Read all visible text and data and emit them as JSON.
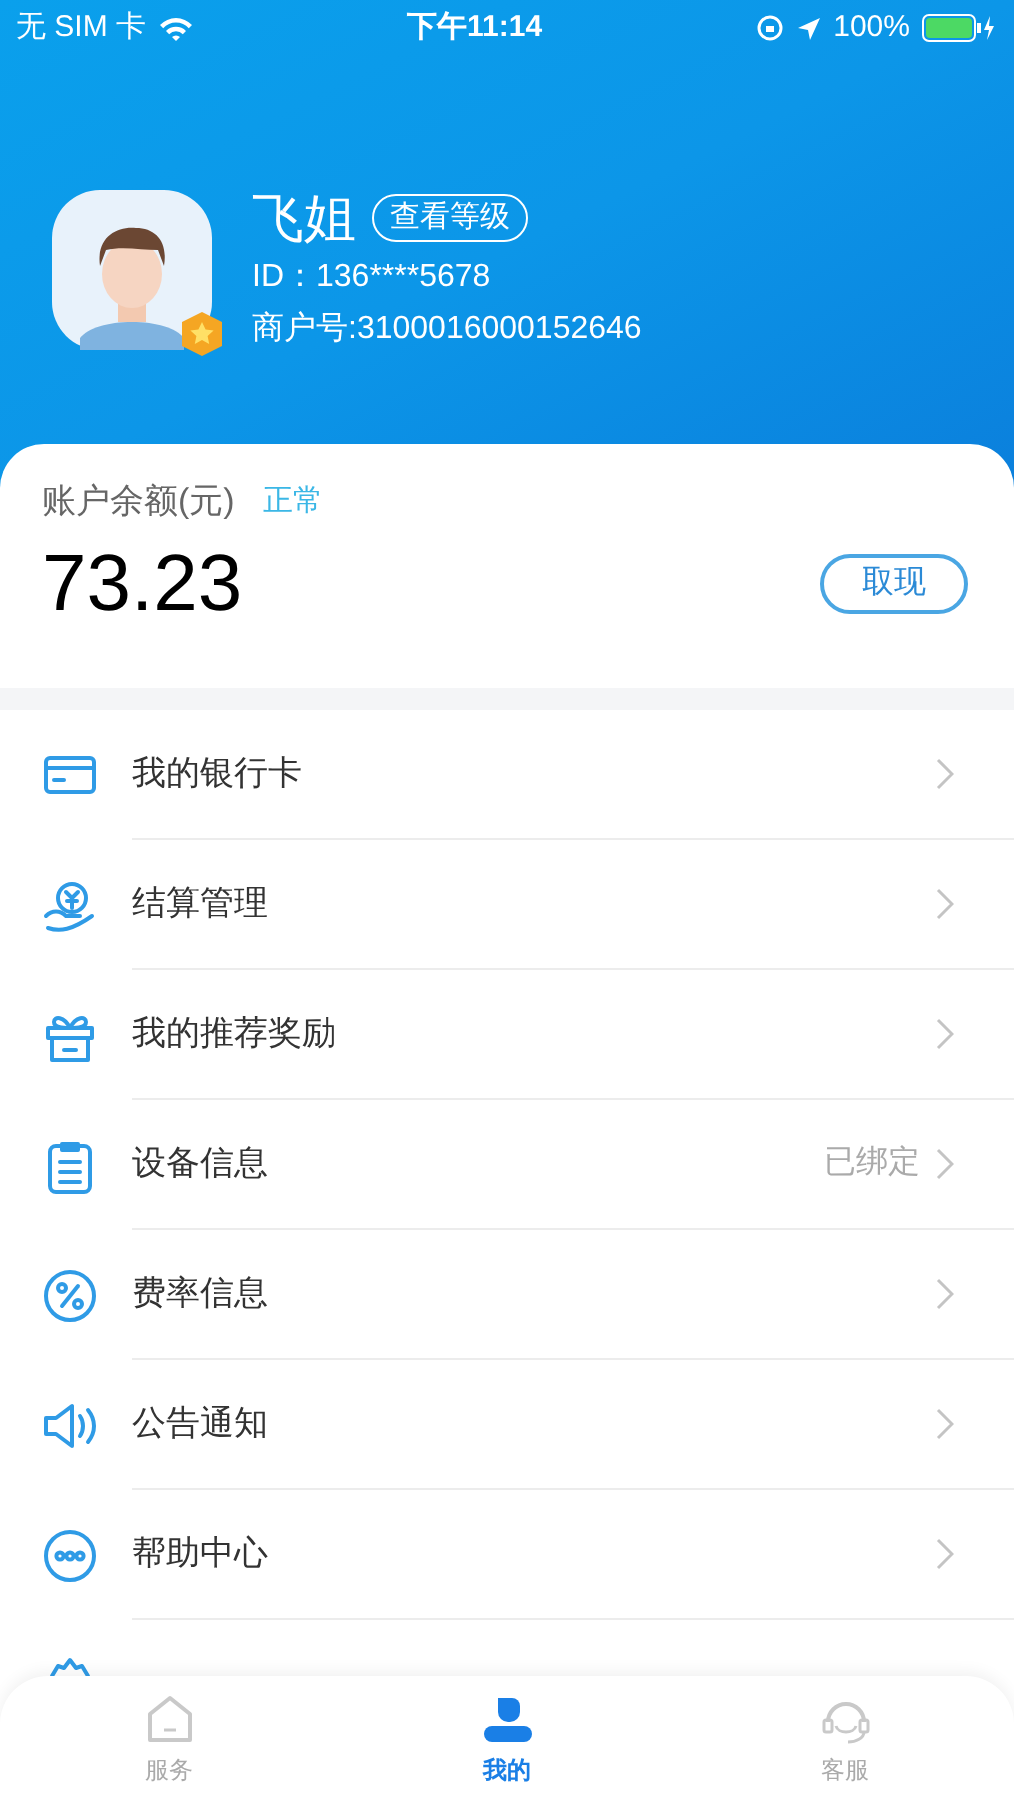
{
  "status_bar": {
    "carrier": "无 SIM 卡",
    "time": "下午11:14",
    "battery": "100%"
  },
  "profile": {
    "name": "飞姐",
    "level_button": "查看等级",
    "id": "ID：136****5678",
    "merchant": "商户号:3100016000152646"
  },
  "balance": {
    "label": "账户余额(元)",
    "status": "正常",
    "amount": "73.23",
    "withdraw_button": "取现"
  },
  "menu": [
    {
      "kind": "card",
      "label": "我的银行卡"
    },
    {
      "kind": "settle",
      "label": "结算管理"
    },
    {
      "kind": "gift",
      "label": "我的推荐奖励"
    },
    {
      "kind": "device",
      "label": "设备信息",
      "value": "已绑定"
    },
    {
      "kind": "rate",
      "label": "费率信息"
    },
    {
      "kind": "notice",
      "label": "公告通知"
    },
    {
      "kind": "help",
      "label": "帮助中心"
    },
    {
      "kind": "settings"
    }
  ],
  "tabs": [
    {
      "kind": "home",
      "label": "服务",
      "selected": false
    },
    {
      "kind": "me",
      "label": "我的",
      "selected": true
    },
    {
      "kind": "service",
      "label": "客服",
      "selected": false
    }
  ]
}
